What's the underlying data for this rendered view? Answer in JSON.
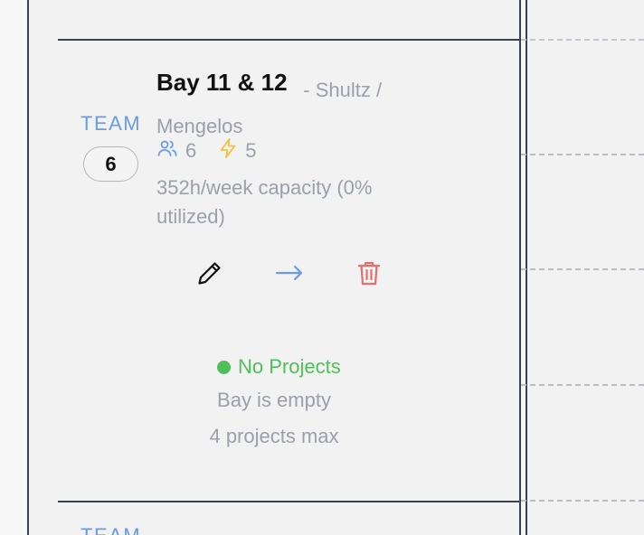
{
  "team": {
    "label": "TEAM",
    "count": "6",
    "next_label": "TEAM"
  },
  "bay": {
    "title": "Bay 11 & 12",
    "separator": "-",
    "owner_first": "Shultz /",
    "owner_second": "Mengelos",
    "members": "6",
    "power": "5",
    "capacity_line1": "352h/week capacity (0%",
    "capacity_line2": "utilized)"
  },
  "actions": {
    "edit_icon": "pencil-icon",
    "move_icon": "arrow-right-icon",
    "delete_icon": "trash-icon"
  },
  "status": {
    "label": "No Projects",
    "empty_note": "Bay is empty",
    "max_note": "4 projects max"
  },
  "colors": {
    "accent_blue": "#6a9be6",
    "status_green": "#4fbf5a",
    "power_yellow": "#f2c23b",
    "delete_red": "#e07070",
    "muted_text": "#9aa0aa",
    "line": "#3a4150"
  }
}
